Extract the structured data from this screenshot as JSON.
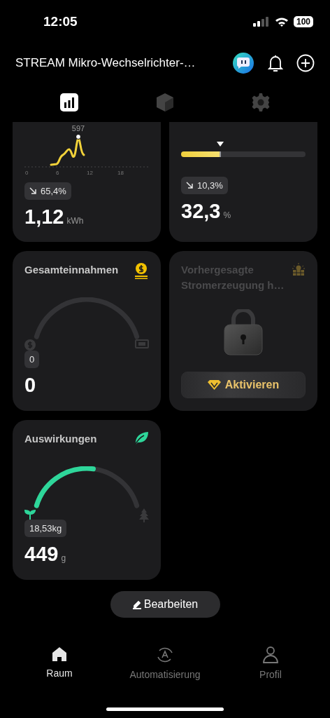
{
  "status_bar": {
    "time": "12:05",
    "battery": "100"
  },
  "header": {
    "title": "STREAM Mikro-Wechselrichter-…"
  },
  "tabs": [
    {
      "kind": "stats",
      "selected": true
    },
    {
      "kind": "device",
      "selected": false
    },
    {
      "kind": "settings",
      "selected": false
    }
  ],
  "cards": [
    {
      "kind": "chart",
      "peak_label": "597",
      "x_ticks": [
        "0",
        "6",
        "12",
        "18"
      ],
      "change": "65,4%",
      "value": "1,12",
      "unit": "kWh"
    },
    {
      "kind": "bar",
      "level": 0.323,
      "change": "10,3%",
      "value": "32,3",
      "unit": "%"
    },
    {
      "kind": "revenue",
      "title": "Gesamteinnahmen",
      "badge": "0",
      "value": "0"
    },
    {
      "kind": "locked",
      "title": "Vorhergesagte Stromerzeugung h…",
      "button": "Aktivieren"
    },
    {
      "kind": "impact",
      "title": "Auswirkungen",
      "badge": "18,53kg",
      "value": "449",
      "unit": "g"
    }
  ],
  "edit_button": "Bearbeiten",
  "bottom_nav": [
    {
      "label": "Raum",
      "selected": true
    },
    {
      "label": "Automatisierung",
      "selected": false
    },
    {
      "label": "Profil",
      "selected": false
    }
  ]
}
